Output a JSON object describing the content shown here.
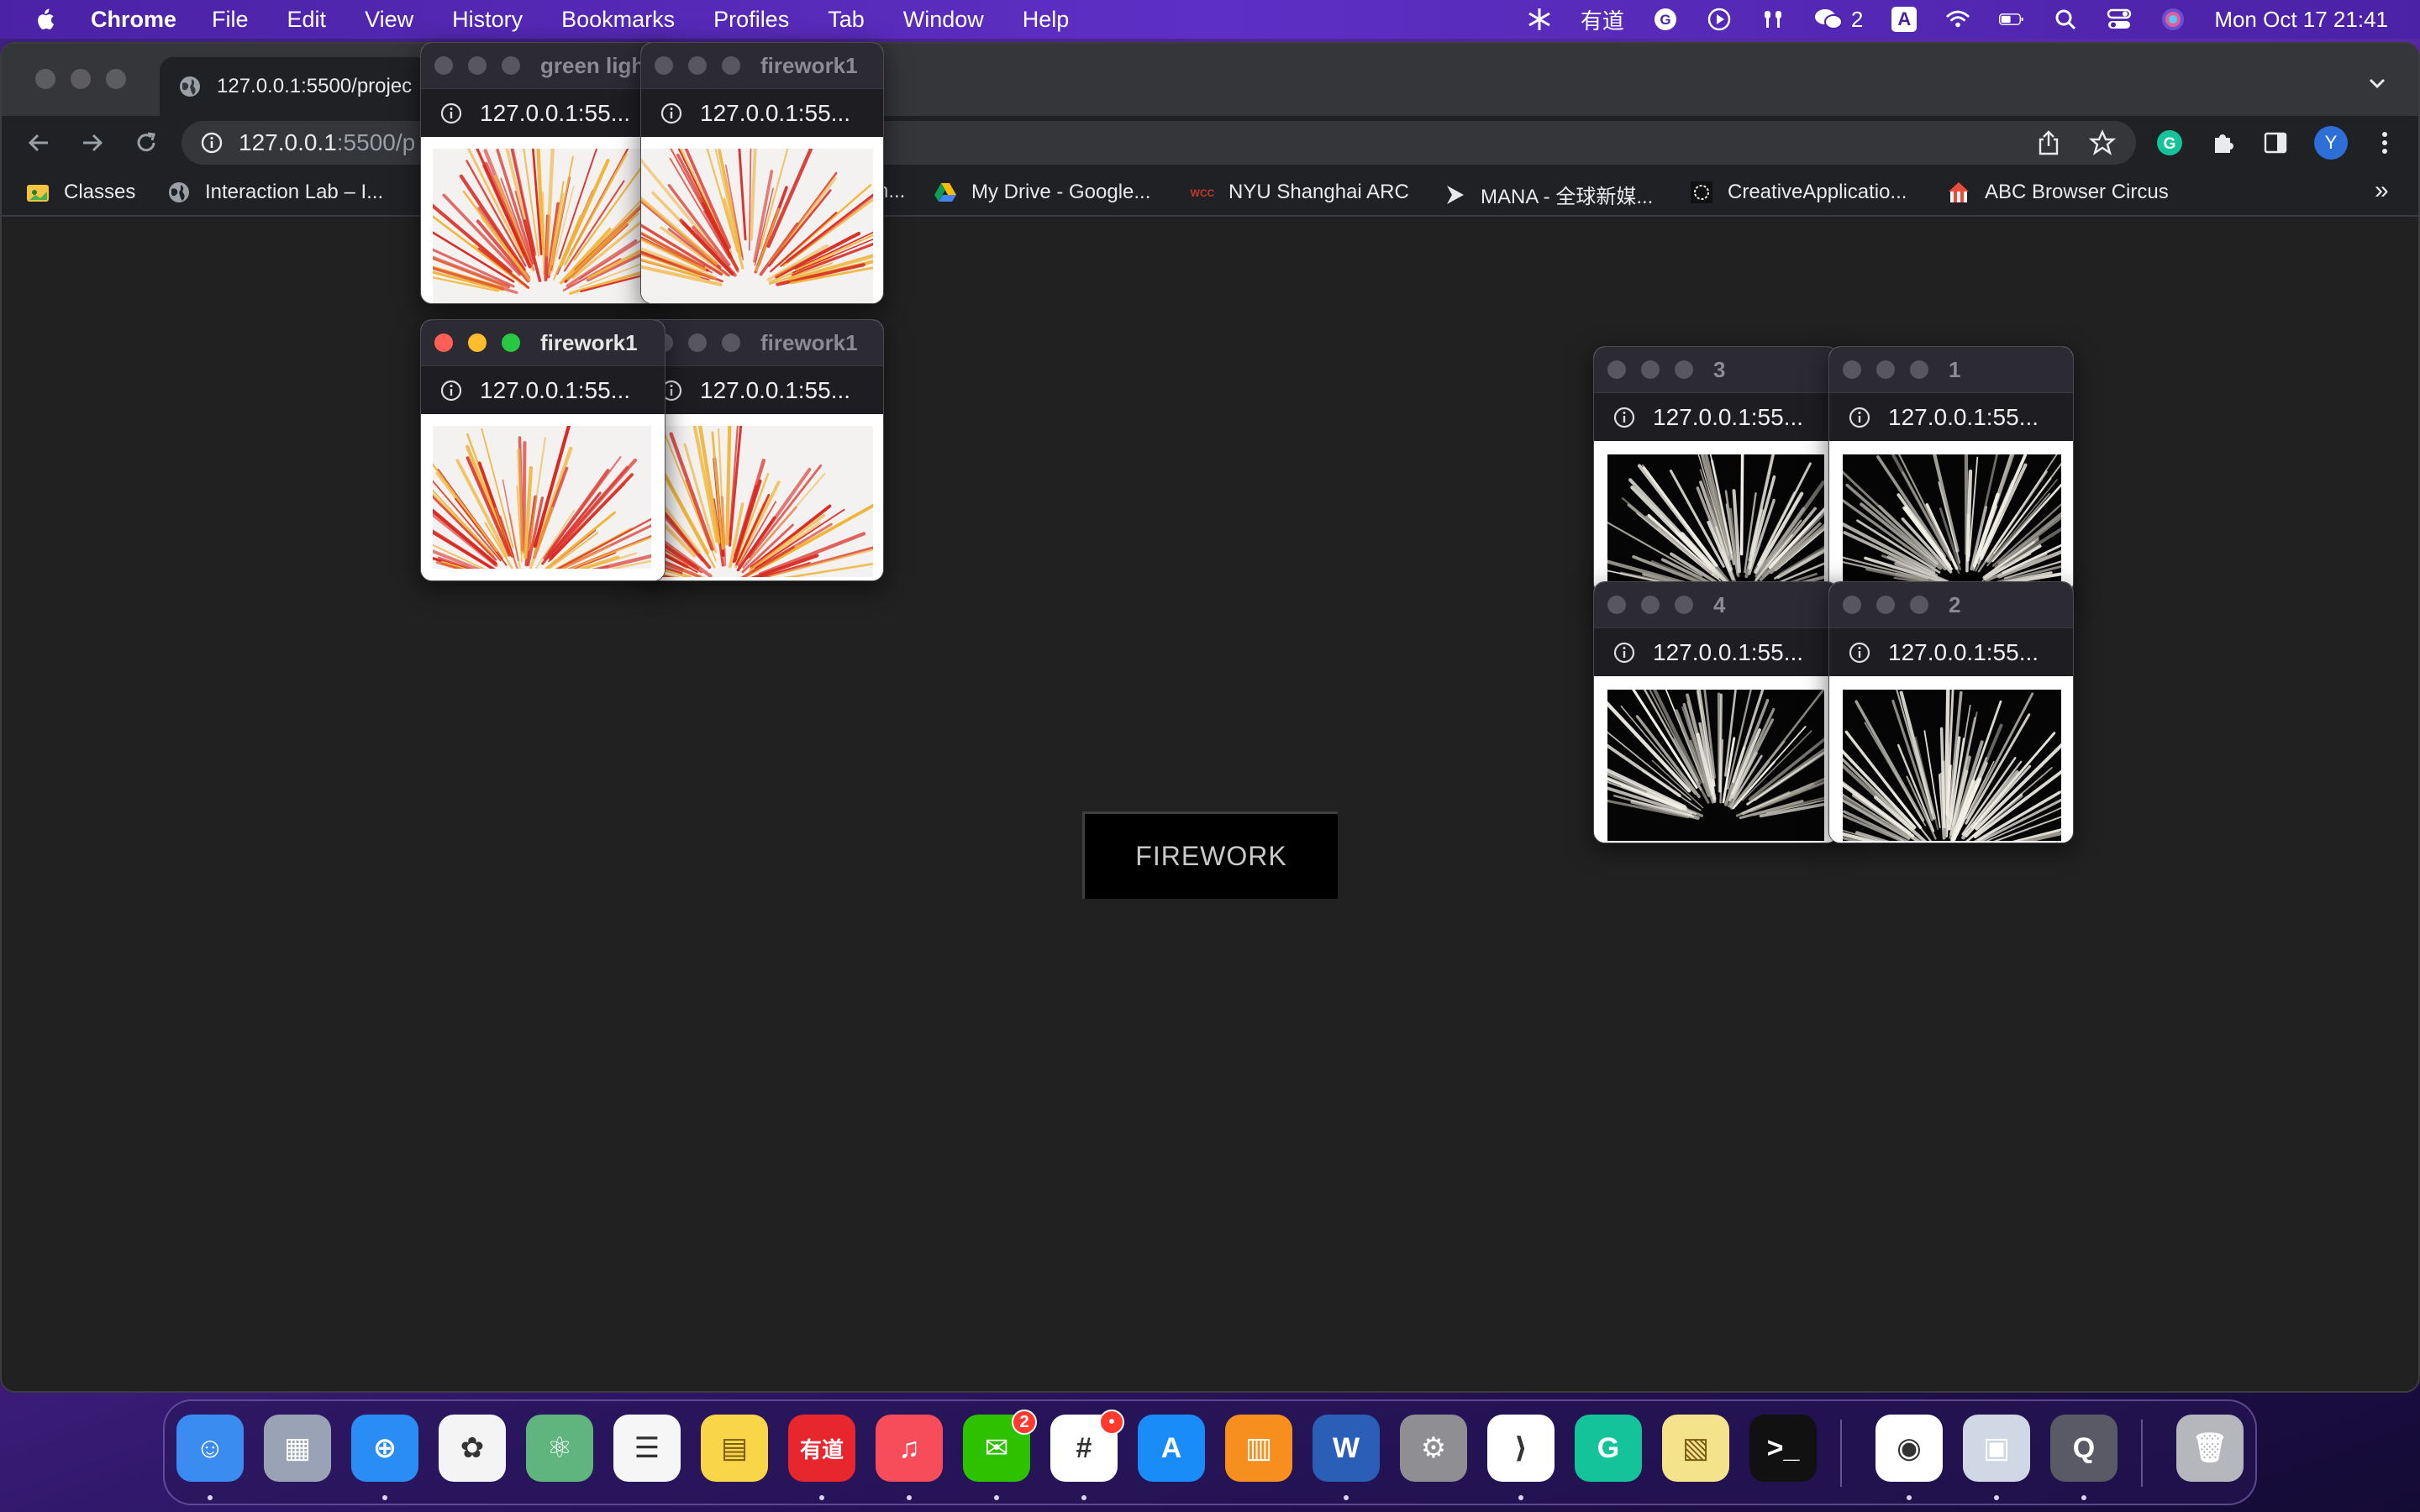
{
  "menubar": {
    "app_name": "Chrome",
    "items": [
      "File",
      "Edit",
      "View",
      "History",
      "Bookmarks",
      "Profiles",
      "Tab",
      "Window",
      "Help"
    ],
    "status": {
      "youdao": "有道",
      "wechat_count": "2",
      "input_source": "A",
      "datetime": "Mon Oct 17  21:41"
    }
  },
  "browser": {
    "tab_title": "127.0.0.1:5500/projec",
    "url_host": "127.0.0.1",
    "url_rest": ":5500/p",
    "profile_initial": "Y",
    "bookmarks": [
      {
        "label": "Classes",
        "icon": "folder-icon",
        "color": "#f5c542"
      },
      {
        "label": "Interaction Lab – I...",
        "icon": "globe-icon",
        "color": "#9aa0a6"
      },
      {
        "label": "n...",
        "icon": "none",
        "color": "#202124"
      },
      {
        "label": "My Drive - Google...",
        "icon": "google-drive-icon",
        "color": "#34a853"
      },
      {
        "label": "NYU Shanghai ARC",
        "icon": "arc-icon",
        "color": "#c0392b"
      },
      {
        "label": "MANA - 全球新媒...",
        "icon": "play-icon",
        "color": "#e8eaed"
      },
      {
        "label": "CreativeApplicatio...",
        "icon": "creative-apps-icon",
        "color": "#e8eaed"
      },
      {
        "label": "ABC Browser Circus",
        "icon": "circus-icon",
        "color": "#e74c3c"
      }
    ],
    "overflow_label": "»"
  },
  "page": {
    "firework_button": "FIREWORK"
  },
  "popups": [
    {
      "id": "p1",
      "title": "green light",
      "url": "127.0.0.1:55...",
      "active": false,
      "style": "red"
    },
    {
      "id": "p2",
      "title": "firework1",
      "url": "127.0.0.1:55...",
      "active": false,
      "style": "red"
    },
    {
      "id": "p3",
      "title": "firework1",
      "url": "127.0.0.1:55...",
      "active": true,
      "style": "red"
    },
    {
      "id": "p4",
      "title": "firework1",
      "url": "127.0.0.1:55...",
      "active": false,
      "style": "red"
    },
    {
      "id": "p5",
      "title": "3",
      "url": "127.0.0.1:55...",
      "active": false,
      "style": "white"
    },
    {
      "id": "p6",
      "title": "1",
      "url": "127.0.0.1:55...",
      "active": false,
      "style": "white"
    },
    {
      "id": "p7",
      "title": "4",
      "url": "127.0.0.1:55...",
      "active": false,
      "style": "white"
    },
    {
      "id": "p8",
      "title": "2",
      "url": "127.0.0.1:55...",
      "active": false,
      "style": "white"
    }
  ],
  "dock": {
    "apps": [
      {
        "name": "Finder",
        "icon": "finder-icon",
        "color": "#3b8cf0",
        "glyph": "☺"
      },
      {
        "name": "Launchpad",
        "icon": "launchpad-icon",
        "color": "#9aa3b5",
        "glyph": "▦"
      },
      {
        "name": "Safari",
        "icon": "safari-icon",
        "color": "#2a8df5",
        "glyph": "⊕"
      },
      {
        "name": "Photos",
        "icon": "photos-icon",
        "color": "#f4f4f4",
        "glyph": "✿"
      },
      {
        "name": "Atom",
        "icon": "atom-icon",
        "color": "#5fb57d",
        "glyph": "⚛"
      },
      {
        "name": "Reminders",
        "icon": "reminders-icon",
        "color": "#f6f6f6",
        "glyph": "☰"
      },
      {
        "name": "Notes",
        "icon": "notes-icon",
        "color": "#f9d548",
        "glyph": "▤"
      },
      {
        "name": "Youdao",
        "icon": "youdao-icon",
        "color": "#e8262d",
        "glyph": "有道"
      },
      {
        "name": "Music",
        "icon": "music-icon",
        "color": "#f74d5b",
        "glyph": "♫"
      },
      {
        "name": "WeChat",
        "icon": "wechat-icon",
        "color": "#2dc100",
        "glyph": "✉",
        "badge": "2"
      },
      {
        "name": "Slack",
        "icon": "slack-icon",
        "color": "#ffffff",
        "glyph": "#",
        "badge": "•"
      },
      {
        "name": "App Store",
        "icon": "app-store-icon",
        "color": "#1a8cf7",
        "glyph": "A"
      },
      {
        "name": "Books",
        "icon": "books-icon",
        "color": "#f68f1e",
        "glyph": "▥"
      },
      {
        "name": "Word",
        "icon": "word-icon",
        "color": "#2b5fb7",
        "glyph": "W"
      },
      {
        "name": "System Preferences",
        "icon": "system-preferences-icon",
        "color": "#8e8e93",
        "glyph": "⚙"
      },
      {
        "name": "VS Code",
        "icon": "vscode-icon",
        "color": "#ffffff",
        "glyph": "⟩"
      },
      {
        "name": "Grammarly",
        "icon": "grammarly-icon",
        "color": "#15c39a",
        "glyph": "G"
      },
      {
        "name": "Stickies",
        "icon": "stickies-icon",
        "color": "#f4e38a",
        "glyph": "▧"
      },
      {
        "name": "Terminal",
        "icon": "terminal-icon",
        "color": "#111111",
        "glyph": ">_"
      },
      {
        "name": "Chrome",
        "icon": "chrome-icon",
        "color": "#ffffff",
        "glyph": "◉"
      },
      {
        "name": "Preview",
        "icon": "preview-icon",
        "color": "#cfd8e4",
        "glyph": "▣"
      },
      {
        "name": "QuickTime",
        "icon": "quicktime-icon",
        "color": "#5a5a66",
        "glyph": "Q"
      },
      {
        "name": "Trash",
        "icon": "trash-icon",
        "color": "#b6b6bd",
        "glyph": "🗑"
      }
    ]
  }
}
